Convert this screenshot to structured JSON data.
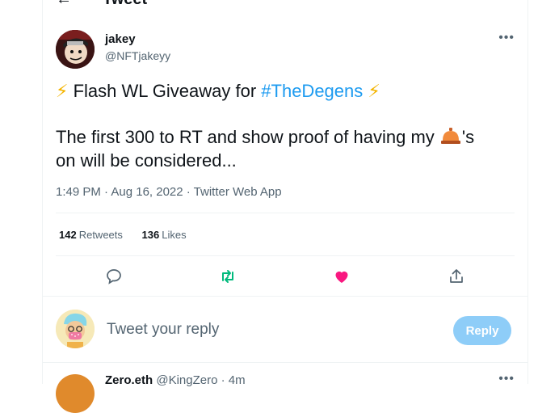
{
  "header": {
    "back_icon": "arrow-left-icon",
    "title": "Tweet"
  },
  "tweet": {
    "author_name": "jakey",
    "author_handle": "@NFTjakeyy",
    "line1_prefix": "Flash WL Giveaway for ",
    "hashtag": "#TheDegens",
    "line2_prefix": "The first 300 to RT and show proof of having my ",
    "line2_suffix": "'s",
    "line3": "on will be considered...",
    "bolt_glyph": "⚡",
    "timestamp": "1:49 PM · Aug 16, 2022 · Twitter Web App",
    "retweets_count": "142",
    "retweets_label": "Retweets",
    "likes_count": "136",
    "likes_label": "Likes"
  },
  "reply_box": {
    "placeholder": "Tweet your reply",
    "button": "Reply"
  },
  "next_tweet": {
    "name": "Zero.eth",
    "handle": "@KingZero",
    "time": "· 4m"
  },
  "colors": {
    "accent": "#1d9bf0",
    "retweet": "#00ba7c",
    "like": "#f91880",
    "bolt": "#f4b400"
  }
}
